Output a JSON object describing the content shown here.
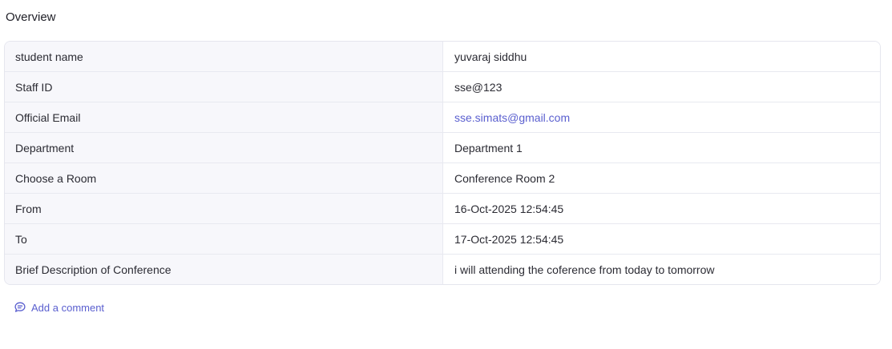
{
  "overview": {
    "title": "Overview"
  },
  "details": {
    "rows": [
      {
        "label": "student name",
        "value": "yuvaraj siddhu"
      },
      {
        "label": "Staff ID",
        "value": "sse@123"
      },
      {
        "label": "Official Email",
        "value": "sse.simats@gmail.com"
      },
      {
        "label": "Department",
        "value": "Department 1"
      },
      {
        "label": "Choose a Room",
        "value": "Conference Room 2"
      },
      {
        "label": "From",
        "value": "16-Oct-2025 12:54:45"
      },
      {
        "label": "To",
        "value": "17-Oct-2025 12:54:45"
      },
      {
        "label": "Brief Description of Conference",
        "value": "i will attending the coference from today to tomorrow"
      }
    ]
  },
  "comments": {
    "add_label": "Add a comment",
    "icon": "comment-icon"
  },
  "colors": {
    "accent": "#5a5fcf",
    "label_bg": "#f7f7fb",
    "border": "#e5e6ee"
  }
}
